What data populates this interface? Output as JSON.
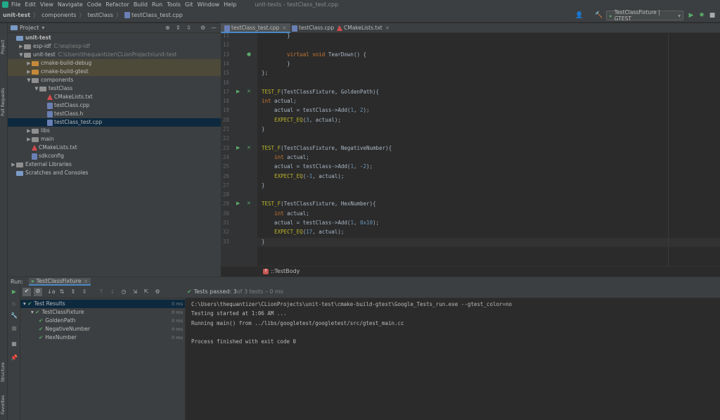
{
  "menubar": {
    "items": [
      "File",
      "Edit",
      "View",
      "Navigate",
      "Code",
      "Refactor",
      "Build",
      "Run",
      "Tools",
      "Git",
      "Window",
      "Help"
    ],
    "window_title": "unit-tests - testClass_test.cpp"
  },
  "navbar": {
    "crumbs": [
      "unit-test",
      "components",
      "testClass",
      "testClass_test.cpp"
    ]
  },
  "toolbar": {
    "run_config": "TestClassFixture | GTEST"
  },
  "left_strip": {
    "project_tab": "Project",
    "pull_requests_tab": "Pull Requests",
    "structure_tab": "Structure",
    "favorites_tab": "Favorites"
  },
  "project": {
    "title": "Project",
    "tree": [
      {
        "label": "unit-test",
        "path": "",
        "indent": 0,
        "arrow": "",
        "icon": "project",
        "bold": true,
        "hl": ""
      },
      {
        "label": "esp-idf",
        "path": "C:\\esp\\esp-idf",
        "indent": 1,
        "arrow": "▶",
        "icon": "folder",
        "hl": ""
      },
      {
        "label": "unit-test",
        "path": "C:\\Users\\thequantizer\\CLionProjects\\unit-test",
        "indent": 1,
        "arrow": "▼",
        "icon": "folder",
        "hl": ""
      },
      {
        "label": "cmake-build-debug",
        "path": "",
        "indent": 2,
        "arrow": "▶",
        "icon": "folder-orange",
        "hl": "orange"
      },
      {
        "label": "cmake-build-gtest",
        "path": "",
        "indent": 2,
        "arrow": "▶",
        "icon": "folder-orange",
        "hl": "orange"
      },
      {
        "label": "components",
        "path": "",
        "indent": 2,
        "arrow": "▼",
        "icon": "folder",
        "hl": ""
      },
      {
        "label": "testClass",
        "path": "",
        "indent": 3,
        "arrow": "▼",
        "icon": "folder",
        "hl": ""
      },
      {
        "label": "CMakeLists.txt",
        "path": "",
        "indent": 4,
        "arrow": "",
        "icon": "cmake",
        "hl": ""
      },
      {
        "label": "testClass.cpp",
        "path": "",
        "indent": 4,
        "arrow": "",
        "icon": "file",
        "hl": ""
      },
      {
        "label": "testClass.h",
        "path": "",
        "indent": 4,
        "arrow": "",
        "icon": "file",
        "hl": ""
      },
      {
        "label": "testClass_test.cpp",
        "path": "",
        "indent": 4,
        "arrow": "",
        "icon": "file",
        "hl": "sel"
      },
      {
        "label": "libs",
        "path": "",
        "indent": 2,
        "arrow": "▶",
        "icon": "folder",
        "hl": ""
      },
      {
        "label": "main",
        "path": "",
        "indent": 2,
        "arrow": "▶",
        "icon": "folder",
        "hl": ""
      },
      {
        "label": "CMakeLists.txt",
        "path": "",
        "indent": 2,
        "arrow": "",
        "icon": "cmake",
        "hl": ""
      },
      {
        "label": "sdkconfig",
        "path": "",
        "indent": 2,
        "arrow": "",
        "icon": "file",
        "hl": ""
      },
      {
        "label": "External Libraries",
        "path": "",
        "indent": 0,
        "arrow": "▶",
        "icon": "lib",
        "hl": ""
      },
      {
        "label": "Scratches and Consoles",
        "path": "",
        "indent": 0,
        "arrow": "",
        "icon": "scratch",
        "hl": ""
      }
    ]
  },
  "editor": {
    "tabs": [
      {
        "label": "testClass_test.cpp",
        "active": true,
        "icon": "file"
      },
      {
        "label": "testClass.cpp",
        "active": false,
        "icon": "file"
      },
      {
        "label": "CMakeLists.txt",
        "active": false,
        "icon": "cmake"
      }
    ],
    "lines": [
      {
        "n": "11",
        "html": "        <span>}</span>"
      },
      {
        "n": "12",
        "html": ""
      },
      {
        "n": "13",
        "html": "        <span class=\"kw\">virtual void</span> TearDown() {"
      },
      {
        "n": "14",
        "html": "        }"
      },
      {
        "n": "15",
        "html": "};"
      },
      {
        "n": "16",
        "html": ""
      },
      {
        "n": "17",
        "html": "<span class=\"mac\">TEST_F</span>(TestClassFixture, GoldenPath){"
      },
      {
        "n": "18",
        "html": "<span class=\"kw\">int</span> actual;"
      },
      {
        "n": "19",
        "html": "    actual = testClass-&gt;Add(<span class=\"num\">1</span>, <span class=\"num\">2</span>);"
      },
      {
        "n": "20",
        "html": "    <span class=\"mac\">EXPECT_EQ</span>(<span class=\"num\">3</span>, actual);"
      },
      {
        "n": "21",
        "html": "}"
      },
      {
        "n": "22",
        "html": ""
      },
      {
        "n": "23",
        "html": "<span class=\"mac\">TEST_F</span>(TestClassFixture, NegativeNumber){"
      },
      {
        "n": "24",
        "html": "    <span class=\"kw\">int</span> actual;"
      },
      {
        "n": "25",
        "html": "    actual = testClass-&gt;Add(<span class=\"num\">1</span>, -<span class=\"num\">2</span>);"
      },
      {
        "n": "26",
        "html": "    <span class=\"mac\">EXPECT_EQ</span>(-<span class=\"num\">1</span>, actual);"
      },
      {
        "n": "27",
        "html": "}"
      },
      {
        "n": "28",
        "html": ""
      },
      {
        "n": "29",
        "html": "<span class=\"mac\">TEST_F</span>(TestClassFixture, HexNumber){"
      },
      {
        "n": "30",
        "html": "    <span class=\"kw\">int</span> actual;"
      },
      {
        "n": "31",
        "html": "    actual = testClass-&gt;Add(<span class=\"num\">1</span>, <span class=\"num\">0x10</span>);"
      },
      {
        "n": "32",
        "html": "    <span class=\"mac\">EXPECT_EQ</span>(<span class=\"num\">17</span>, actual);"
      },
      {
        "n": "33",
        "html": "}"
      }
    ],
    "breadcrumb": "::TestBody",
    "breadcrumb_badge": "f"
  },
  "run": {
    "label": "Run:",
    "config_tab": "TestClassFixture",
    "status_text": "Tests passed: 3",
    "status_suffix": " of 3 tests – 0 ms",
    "tests": [
      {
        "label": "Test Results",
        "indent": 0,
        "ms": "0 ms",
        "sel": true
      },
      {
        "label": "TestClassFixture",
        "indent": 1,
        "ms": "0 ms",
        "sel": false
      },
      {
        "label": "GoldenPath",
        "indent": 2,
        "ms": "0 ms",
        "sel": false
      },
      {
        "label": "NegativeNumber",
        "indent": 2,
        "ms": "0 ms",
        "sel": false
      },
      {
        "label": "HexNumber",
        "indent": 2,
        "ms": "0 ms",
        "sel": false
      }
    ],
    "console": [
      "C:\\Users\\thequantizer\\CLionProjects\\unit-test\\cmake-build-gtest\\Google_Tests_run.exe --gtest_color=no",
      "Testing started at 1:06 AM ...",
      "Running main() from ../libs/googletest/googletest/src/gtest_main.cc",
      "",
      "Process finished with exit code 0"
    ]
  }
}
